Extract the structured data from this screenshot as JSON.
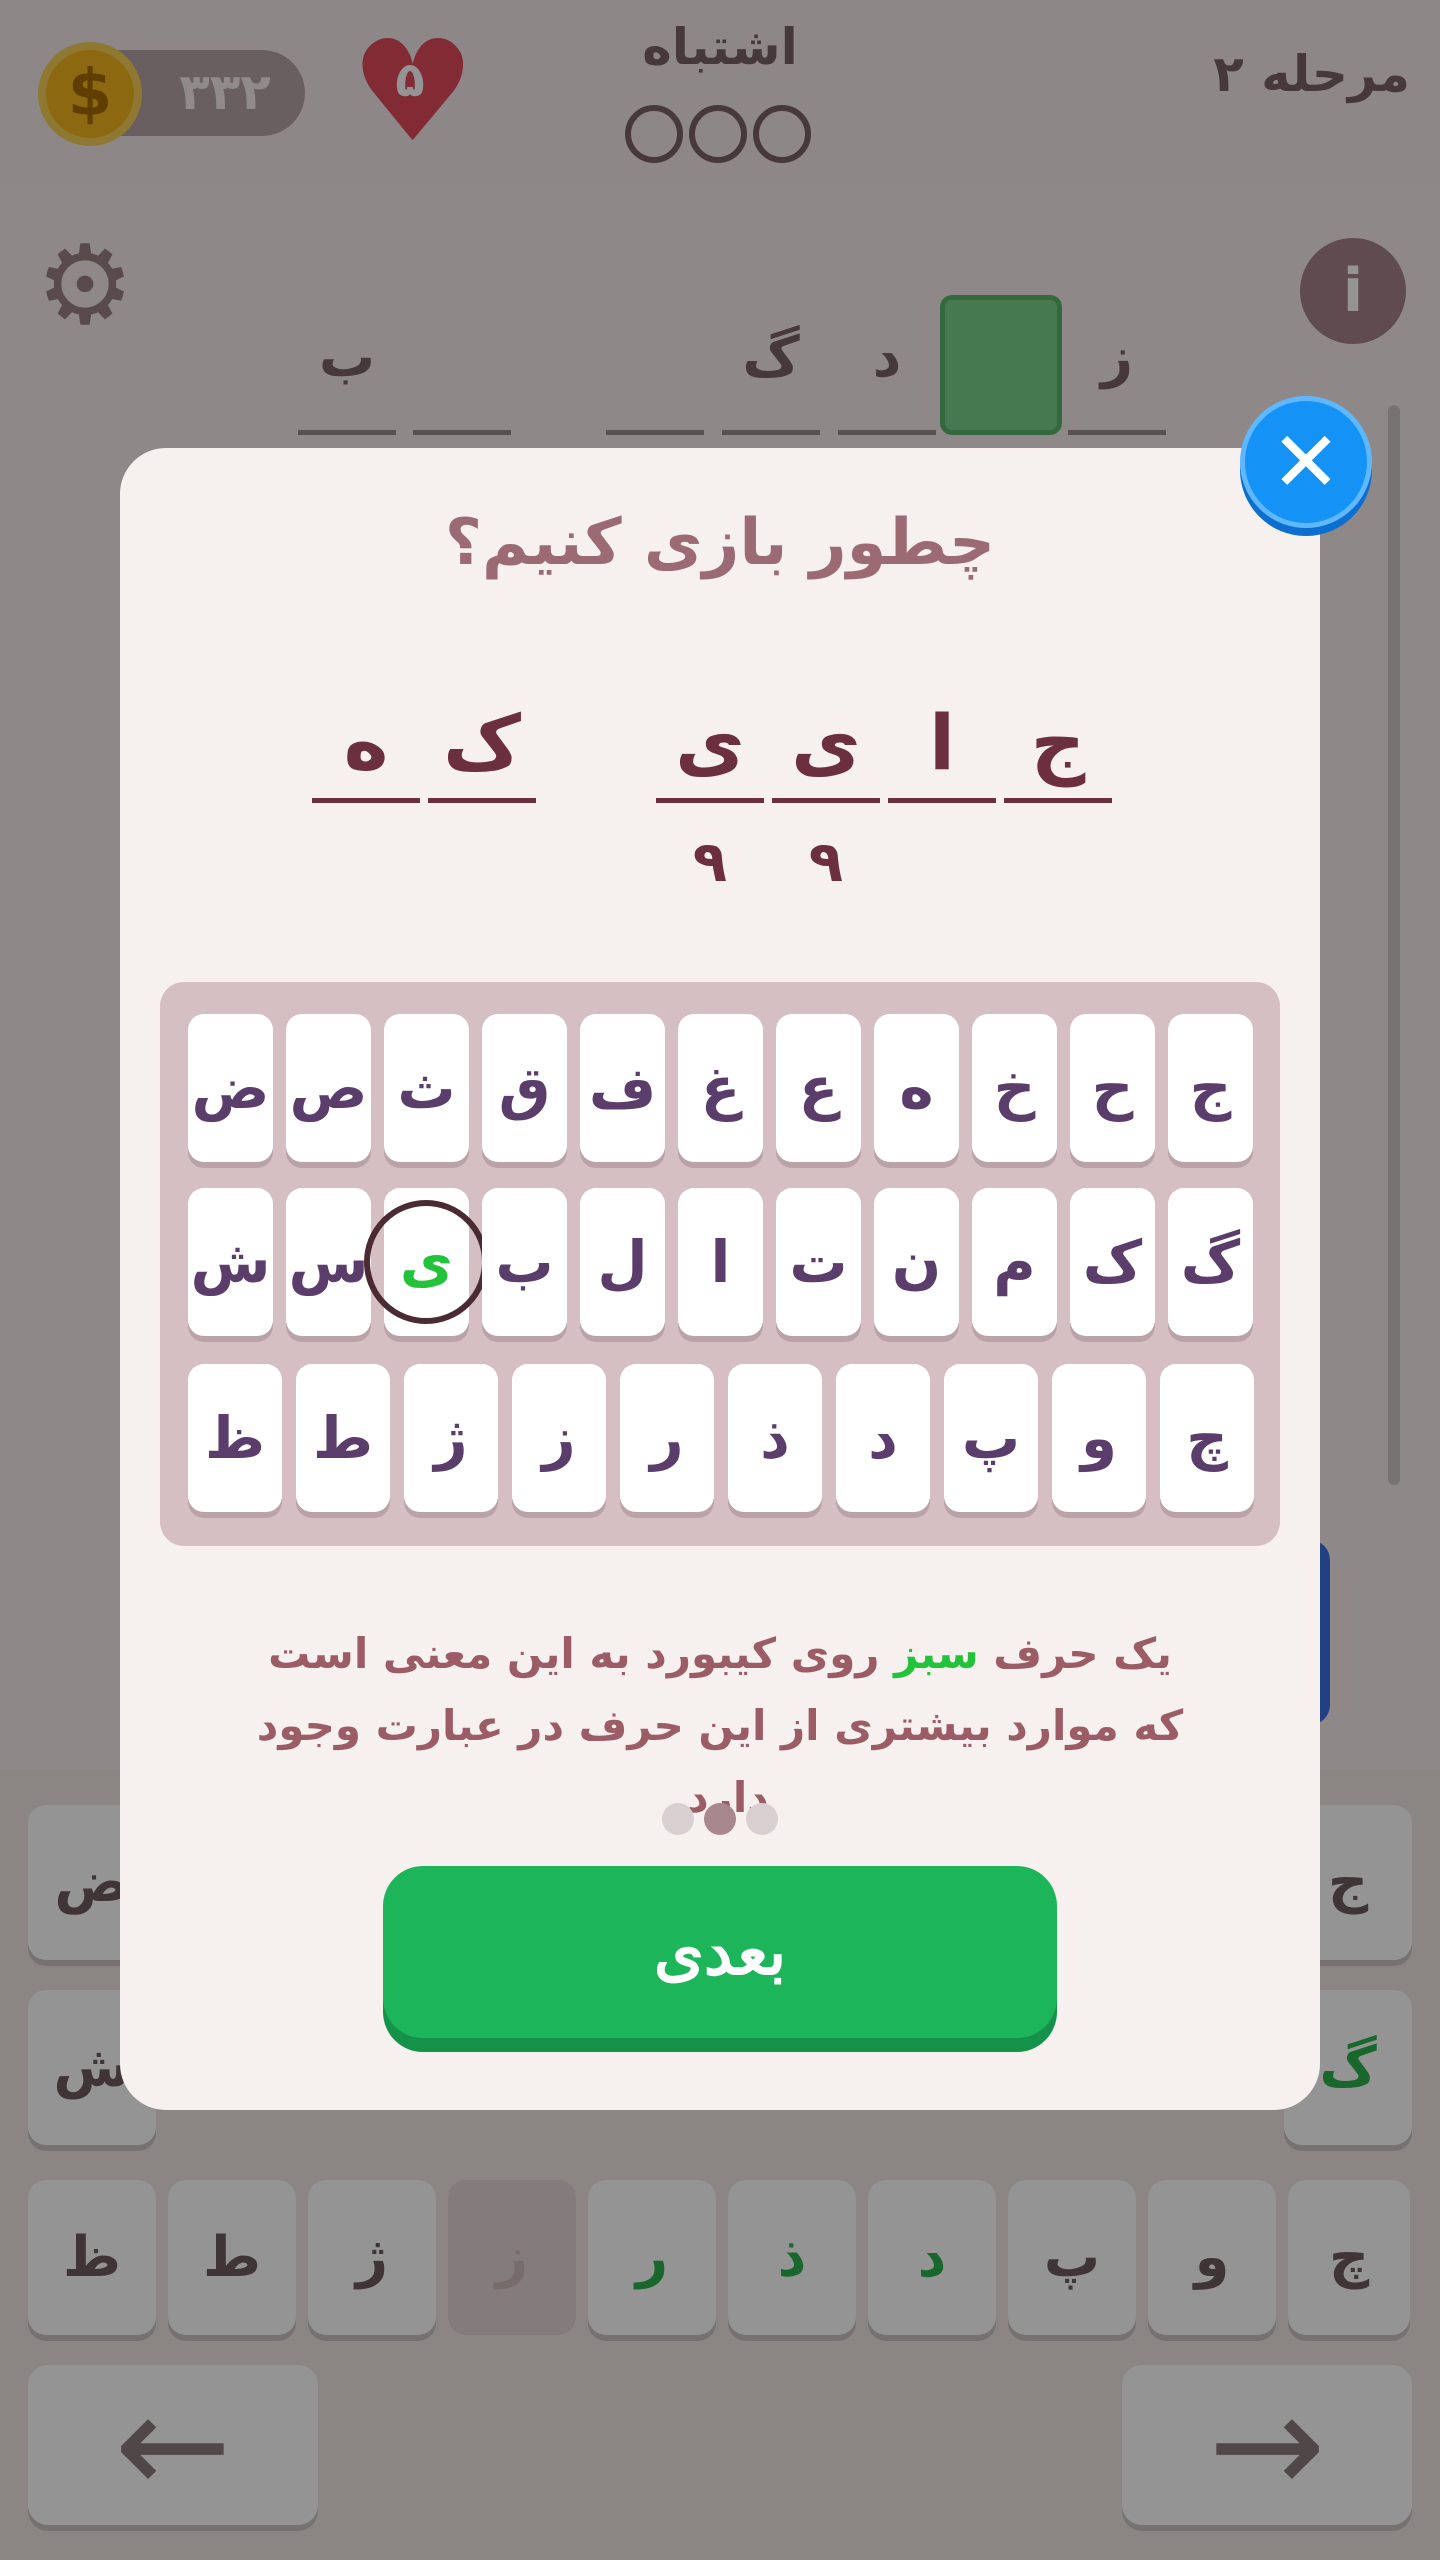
{
  "header": {
    "coins": "۳۳۲",
    "coin_symbol": "$",
    "hearts": "۵",
    "mistakes_label": "اشتباه",
    "level_label": "مرحله ۲"
  },
  "board": {
    "slots": [
      "ب",
      "",
      "",
      "گ",
      "د",
      "",
      "ز"
    ]
  },
  "bg_keyboard": {
    "row1": [
      "ض",
      "ج"
    ],
    "row2": [
      "ش",
      "گ"
    ],
    "row3": [
      "ظ",
      "ط",
      "ژ",
      "ز",
      "ر",
      "ذ",
      "د",
      "پ",
      "و",
      "چ"
    ]
  },
  "modal": {
    "title": "چطور بازی کنیم؟",
    "example_word1": [
      "ه",
      "ک"
    ],
    "example_word2": [
      "ی",
      "ی",
      "ا",
      "ج"
    ],
    "example_numbers": [
      "۹",
      "۹"
    ],
    "keyboard": {
      "row1": [
        "ض",
        "ص",
        "ث",
        "ق",
        "ف",
        "غ",
        "ع",
        "ه",
        "خ",
        "ح",
        "ج"
      ],
      "row2": [
        "ش",
        "س",
        "ی",
        "ب",
        "ل",
        "ا",
        "ت",
        "ن",
        "م",
        "ک",
        "گ"
      ],
      "row3": [
        "ظ",
        "ط",
        "ژ",
        "ز",
        "ر",
        "ذ",
        "د",
        "پ",
        "و",
        "چ"
      ]
    },
    "desc_part1": "یک حرف ",
    "desc_green": "سبز",
    "desc_part2": " روی کیبورد به این معنی است که موارد بیشتری از این حرف در عبارت وجود دارد.",
    "next_label": "بعدی",
    "close_label": "✕",
    "colors": {
      "green_key": "#22c23a",
      "next_button": "#1db55a",
      "close_button": "#1592f5"
    }
  }
}
